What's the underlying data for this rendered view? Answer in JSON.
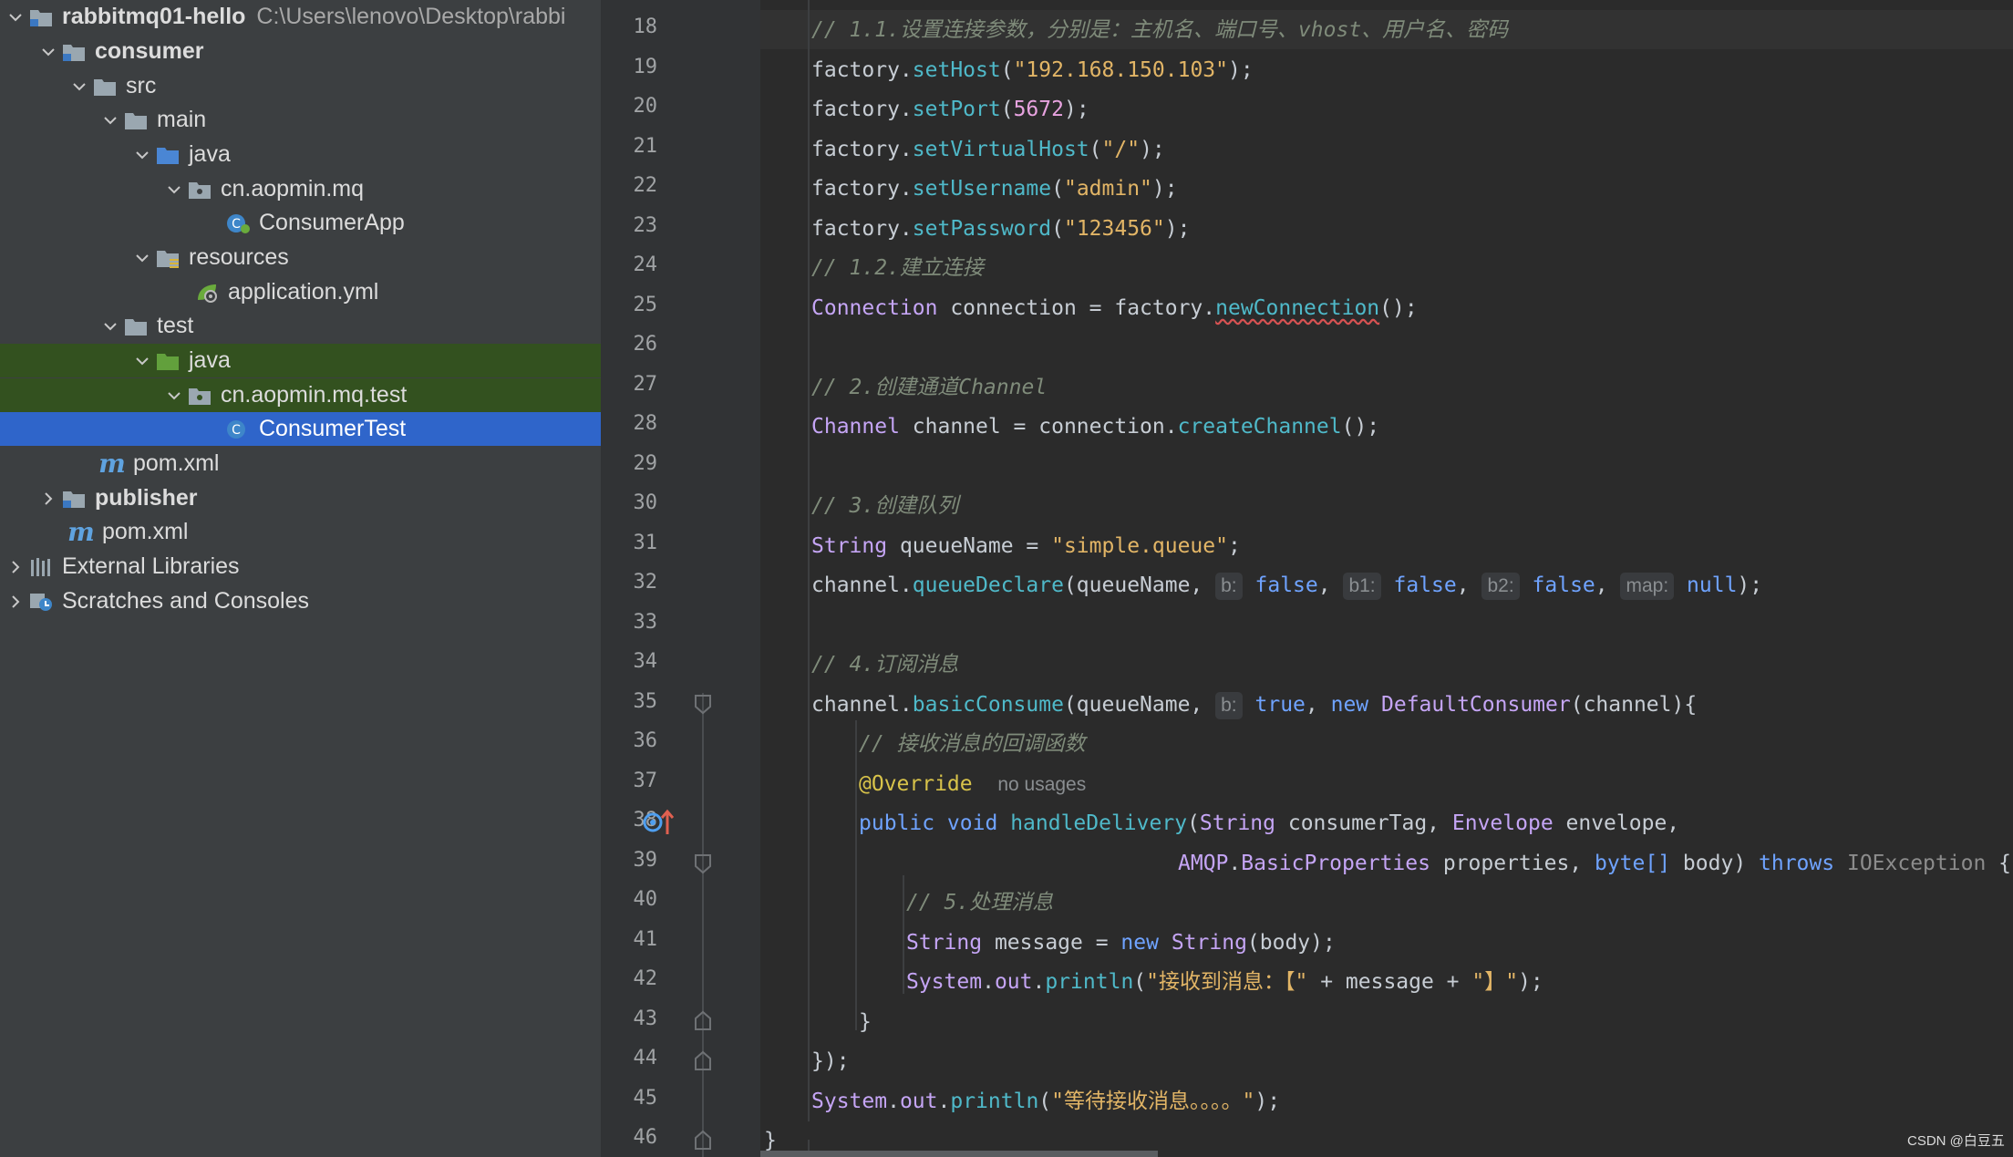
{
  "project_tree": {
    "root_name": "rabbitmq01-hello",
    "root_path": "C:\\Users\\lenovo\\Desktop\\rabbi",
    "consumer": "consumer",
    "src": "src",
    "main": "main",
    "java_main": "java",
    "pkg_main": "cn.aopmin.mq",
    "consumer_app": "ConsumerApp",
    "resources": "resources",
    "application_yml": "application.yml",
    "test": "test",
    "java_test": "java",
    "pkg_test": "cn.aopmin.mq.test",
    "consumer_test": "ConsumerTest",
    "pom_consumer": "pom.xml",
    "publisher": "publisher",
    "pom_root": "pom.xml",
    "external_libraries": "External Libraries",
    "scratches": "Scratches and Consoles",
    "maven_mark": "m"
  },
  "line_numbers": [
    "18",
    "19",
    "20",
    "21",
    "22",
    "23",
    "24",
    "25",
    "26",
    "27",
    "28",
    "29",
    "30",
    "31",
    "32",
    "33",
    "34",
    "35",
    "36",
    "37",
    "38",
    "39",
    "40",
    "41",
    "42",
    "43",
    "44",
    "45",
    "46"
  ],
  "code": {
    "l18": {
      "comment": "// 1.1.设置连接参数，分别是：主机名、端口号、vhost、用户名、密码"
    },
    "l19": {
      "obj": "factory.",
      "method": "setHost",
      "open": "(",
      "arg": "\"192.168.150.103\"",
      "close": ");"
    },
    "l20": {
      "obj": "factory.",
      "method": "setPort",
      "open": "(",
      "arg": "5672",
      "close": ");"
    },
    "l21": {
      "obj": "factory.",
      "method": "setVirtualHost",
      "open": "(",
      "arg": "\"/\"",
      "close": ");"
    },
    "l22": {
      "obj": "factory.",
      "method": "setUsername",
      "open": "(",
      "arg": "\"admin\"",
      "close": ");"
    },
    "l23": {
      "obj": "factory.",
      "method": "setPassword",
      "open": "(",
      "arg": "\"123456\"",
      "close": ");"
    },
    "l24": {
      "comment": "// 1.2.建立连接"
    },
    "l25": {
      "type": "Connection",
      "rest": " connection = factory.",
      "method": "newConnection",
      "tail": "();"
    },
    "l27": {
      "comment": "// 2.创建通道Channel"
    },
    "l28": {
      "type": "Channel",
      "rest": " channel = connection.",
      "method": "createChannel",
      "tail": "();"
    },
    "l30": {
      "comment": "// 3.创建队列"
    },
    "l31": {
      "type": "String",
      "rest": " queueName = ",
      "str": "\"simple.queue\"",
      "tail": ";"
    },
    "l32": {
      "obj": "channel.",
      "method": "queueDeclare",
      "p1": "(queueName, ",
      "h1": "b:",
      "v1": "false",
      "c1": ", ",
      "h2": "b1:",
      "v2": "false",
      "c2": ", ",
      "h3": "b2:",
      "v3": "false",
      "c3": ", ",
      "h4": "map:",
      "v4": "null",
      "tail": ");"
    },
    "l34": {
      "comment": "// 4.订阅消息"
    },
    "l35": {
      "obj": "channel.",
      "method": "basicConsume",
      "p1": "(queueName, ",
      "h1": "b:",
      "v1": "true",
      "c1": ", ",
      "kw": "new",
      "sp": " ",
      "type": "DefaultConsumer",
      "tail": "(channel){"
    },
    "l36": {
      "comment": "// 接收消息的回调函数"
    },
    "l37": {
      "ann": "@Override",
      "usage": "no usages"
    },
    "l38": {
      "kw": "public void",
      "sp": " ",
      "method": "handleDelivery",
      "open": "(",
      "t1": "String",
      "p1": " consumerTag, ",
      "t2": "Envelope",
      "p2": " envelope,"
    },
    "l39": {
      "t1": "AMQP",
      "p0": ".",
      "t2": "BasicProperties",
      "p1": " properties, ",
      "kw1": "byte[]",
      "p2": " body) ",
      "kw2": "throws",
      "sp": " ",
      "ex": "IOException",
      "tail": " {"
    },
    "l40": {
      "comment": "// 5.处理消息"
    },
    "l41": {
      "type": "String",
      "rest": " message = ",
      "kw": "new",
      "sp": " ",
      "type2": "String",
      "tail": "(body);"
    },
    "l42": {
      "type": "System",
      "dot": ".",
      "field": "out",
      "p": ".",
      "method": "println",
      "open": "(",
      "s1": "\"接收到消息：【\"",
      "mid": " + message + ",
      "s2": "\"】\"",
      "close": ");"
    },
    "l43": {
      "text": "}"
    },
    "l44": {
      "text": "});"
    },
    "l45": {
      "type": "System",
      "dot": ".",
      "field": "out",
      "p": ".",
      "method": "println",
      "open": "(",
      "s1": "\"等待接收消息。。。。\"",
      "close": ");"
    },
    "l46": {
      "text": "}"
    }
  },
  "watermark": "CSDN @白豆五",
  "colors": {
    "tree_bg": "#3c3f41",
    "selection": "#2f65ca",
    "test_highlight": "#33511f",
    "editor_bg": "#2b2b2b",
    "gutter_bg": "#313335"
  }
}
